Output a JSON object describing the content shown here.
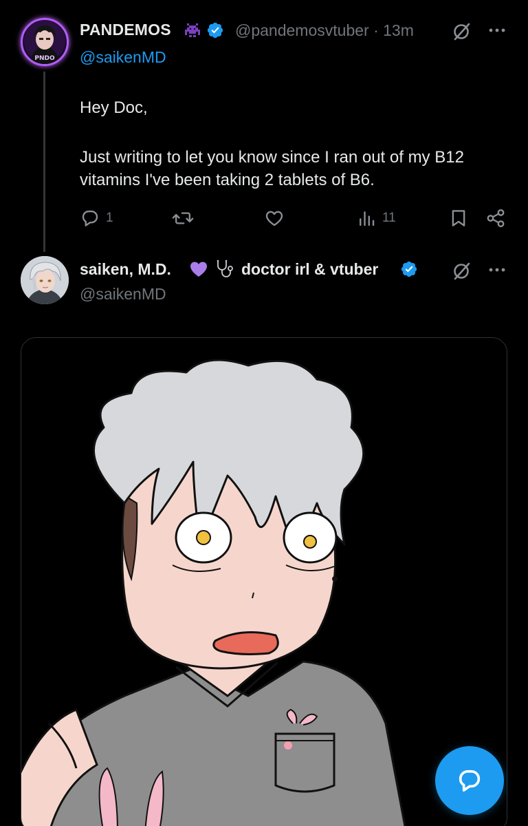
{
  "tweet1": {
    "display_name": "PANDEMOS",
    "handle_time": "@pandemosvtuber · 13m",
    "replying_to": "@saikenMD",
    "text_line1": "Hey Doc,",
    "text_line2": "Just writing to let you know since I ran out of my B12 vitamins I've been taking 2 tablets of B6.",
    "reply_count": "1",
    "repost_count": "",
    "like_count": "",
    "view_count": "11",
    "icons": [
      "space-invader-icon",
      "verified-badge-icon",
      "grok-icon",
      "more-icon",
      "reply-icon",
      "repost-icon",
      "like-icon",
      "views-icon",
      "bookmark-icon",
      "share-icon"
    ]
  },
  "tweet2": {
    "display_name": "saiken, M.D.",
    "bio_tag": "doctor irl & vtuber",
    "handle": "@saikenMD",
    "icons": [
      "purple-heart-icon",
      "stethoscope-icon",
      "verified-badge-icon",
      "grok-icon",
      "more-icon"
    ]
  },
  "media": {
    "description_icon": "shocked-doctor-drawing"
  },
  "fab": {
    "icon": "compose-reply-icon"
  },
  "colors": {
    "background": "#000000",
    "text_primary": "#e7e9ea",
    "text_secondary": "#71767b",
    "accent": "#1d9bf0",
    "purple": "#b45cff"
  }
}
